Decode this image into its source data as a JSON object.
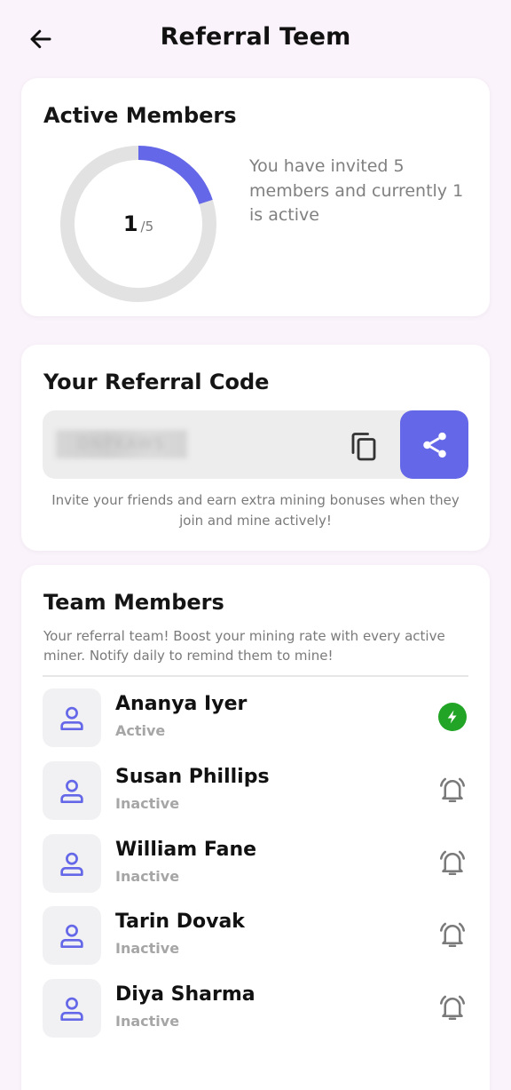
{
  "header": {
    "title": "Referral Teem",
    "back_icon": "arrow-left-icon"
  },
  "active_members": {
    "title": "Active Members",
    "active_count": "1",
    "total_label": "/5",
    "progress_fraction": 0.2,
    "description": "You have invited 5 members and currently 1 is active",
    "colors": {
      "progress": "#6467e8",
      "track": "#e2e2e2"
    }
  },
  "referral_code": {
    "title": "Your Referral Code",
    "code_value": "DNPKAWS",
    "copy_icon": "copy-icon",
    "share_icon": "share-icon",
    "hint": "Invite your friends and earn extra mining bonuses when they join and mine actively!",
    "colors": {
      "accent": "#6467e8"
    }
  },
  "team": {
    "title": "Team Members",
    "description": "Your referral team! Boost your mining rate with every active miner. Notify daily to remind them to mine!",
    "members": [
      {
        "name": "Ananya Iyer",
        "status": "Active",
        "action_icon": "lightning-badge-icon"
      },
      {
        "name": "Susan Phillips",
        "status": "Inactive",
        "action_icon": "bell-ring-icon"
      },
      {
        "name": "William Fane",
        "status": "Inactive",
        "action_icon": "bell-ring-icon"
      },
      {
        "name": "Tarin Dovak",
        "status": "Inactive",
        "action_icon": "bell-ring-icon"
      },
      {
        "name": "Diya Sharma",
        "status": "Inactive",
        "action_icon": "bell-ring-icon"
      }
    ],
    "colors": {
      "active_badge": "#22a526",
      "avatar_icon": "#6467e8",
      "bell": "#7a7a7a"
    }
  }
}
